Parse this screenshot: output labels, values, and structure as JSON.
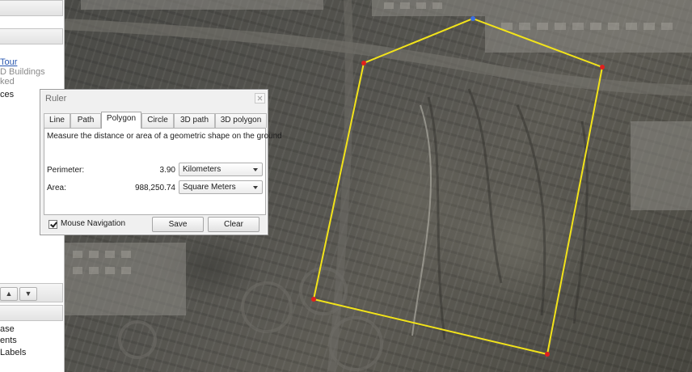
{
  "sidebar": {
    "tour_link": "Tour",
    "buildings": "D Buildings",
    "checked": "ked",
    "places": "ces",
    "layers": [
      "ase",
      "ents",
      "Labels"
    ],
    "up_arrow": "▲",
    "down_arrow": "▼"
  },
  "ruler": {
    "title": "Ruler",
    "tabs": [
      "Line",
      "Path",
      "Polygon",
      "Circle",
      "3D path",
      "3D polygon"
    ],
    "active_tab": "Polygon",
    "description": "Measure the distance or area of a geometric shape on the ground",
    "perimeter": {
      "label": "Perimeter:",
      "value": "3.90",
      "unit": "Kilometers"
    },
    "area": {
      "label": "Area:",
      "value": "988,250.74",
      "unit": "Square Meters"
    },
    "mouse_navigation": {
      "label": "Mouse Navigation",
      "checked": true
    },
    "save_label": "Save",
    "clear_label": "Clear"
  },
  "map": {
    "polygon_color": "#f2e31a",
    "vertex_color": "#e0201e",
    "active_vertex_color": "#3c6fe0"
  }
}
